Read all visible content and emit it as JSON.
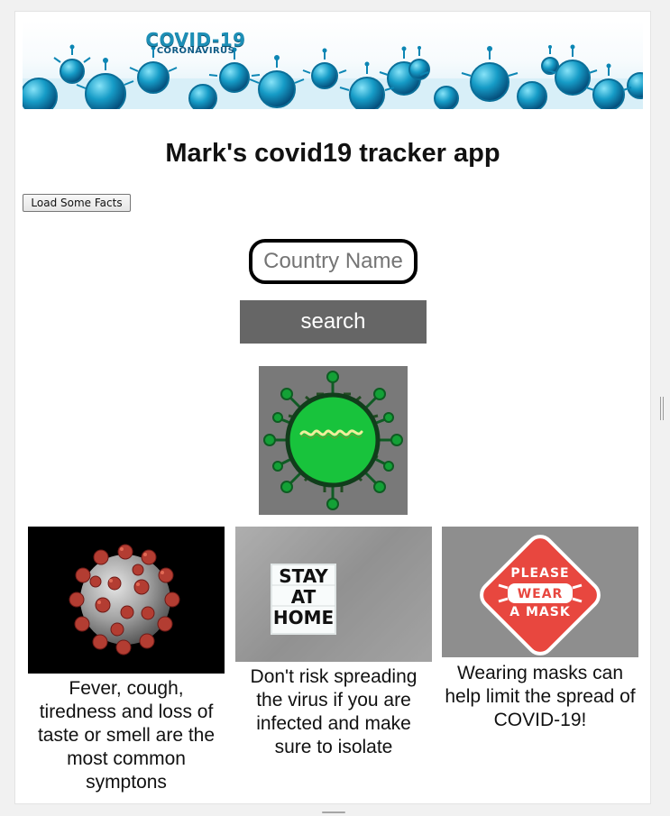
{
  "banner": {
    "title": "COVID-19",
    "subtitle": "CORONAVIRUS",
    "accent_color": "#1d8fb6",
    "secondary_color": "#0f5b85"
  },
  "page": {
    "title": "Mark's covid19 tracker app"
  },
  "actions": {
    "facts_button_label": "Load Some Facts",
    "search_button_label": "search"
  },
  "search": {
    "placeholder": "Country Name",
    "value": ""
  },
  "virus_image": {
    "icon": "green-virus-icon"
  },
  "cards": [
    {
      "icon": "coronavirus-microscope-icon",
      "text": "Fever, cough, tiredness and loss of taste or smell are the most common symptons"
    },
    {
      "icon": "stay-at-home-sign-icon",
      "sign_lines": [
        "STAY",
        "AT",
        "HOME"
      ],
      "text": "Don't risk spreading the virus if you are infected and make sure to isolate"
    },
    {
      "icon": "please-wear-mask-sign-icon",
      "sign_lines": [
        "PLEASE",
        "WEAR",
        "A MASK"
      ],
      "text": "Wearing masks can help limit the spread of COVID-19!"
    }
  ],
  "colors": {
    "search_button": "#666666",
    "virus_background": "#797979",
    "virus_green": "#18c33c",
    "mask_red": "#e8473f",
    "page_background": "#ffffff"
  }
}
